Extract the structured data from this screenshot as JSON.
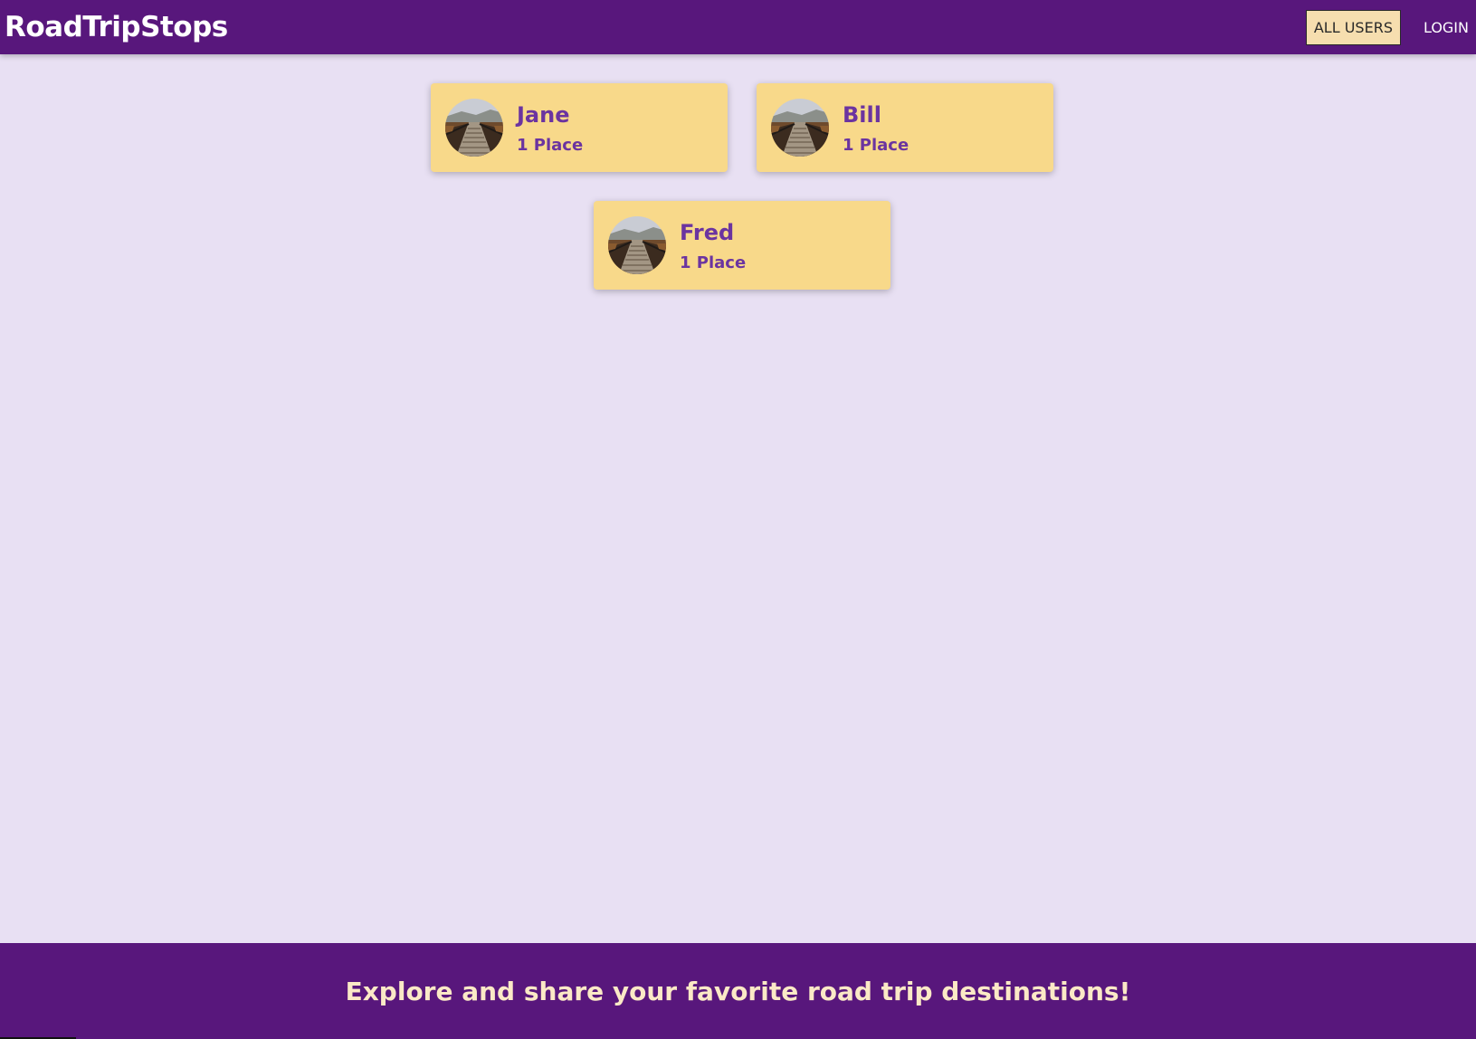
{
  "header": {
    "title": "RoadTripStops",
    "nav": {
      "all_users": "ALL USERS",
      "login": "LOGIN"
    }
  },
  "users": [
    {
      "name": "Jane",
      "places": "1 Place",
      "avatar_icon": "boardwalk-photo"
    },
    {
      "name": "Bill",
      "places": "1 Place",
      "avatar_icon": "boardwalk-photo"
    },
    {
      "name": "Fred",
      "places": "1 Place",
      "avatar_icon": "boardwalk-photo"
    }
  ],
  "footer": {
    "tagline": "Explore and share your favorite road trip destinations!"
  },
  "colors": {
    "header_bg": "#58177c",
    "page_bg": "#e8e0f3",
    "card_bg": "#f8d98a",
    "accent_text": "#6b34a0",
    "active_nav_bg": "#f6deaf",
    "footer_text": "#fbe9c6"
  }
}
